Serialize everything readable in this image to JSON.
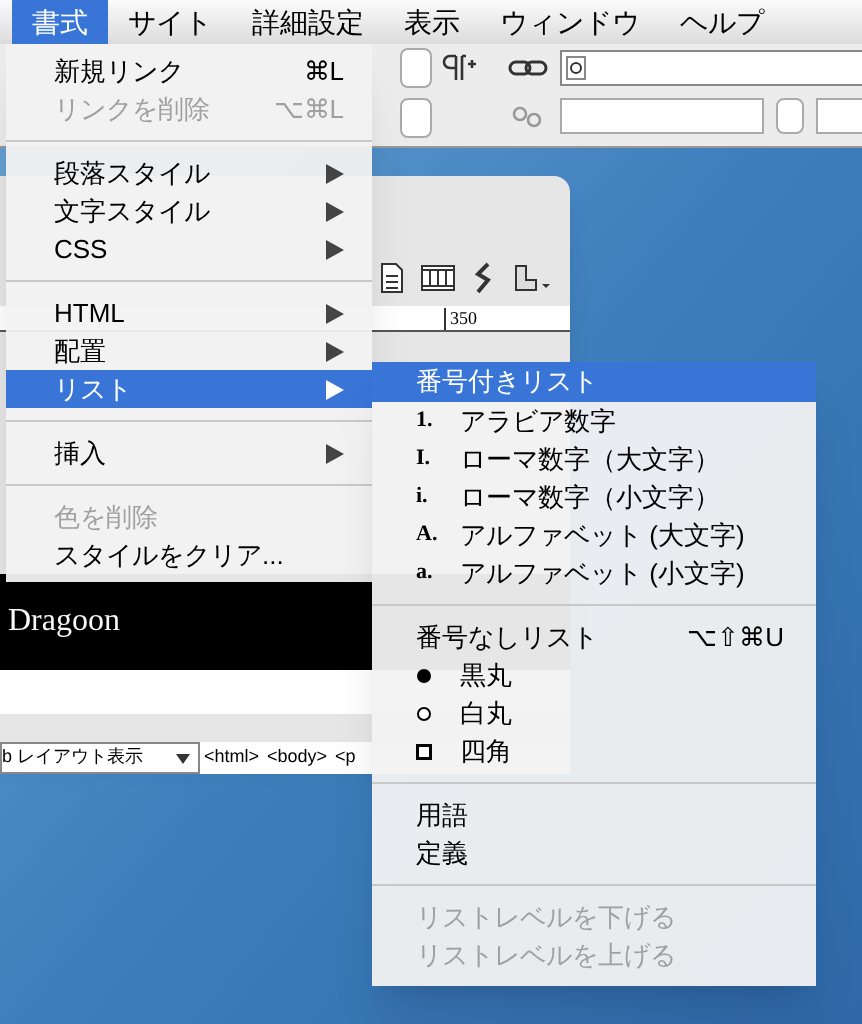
{
  "menubar": [
    {
      "label": "書式",
      "selected": true
    },
    {
      "label": "サイト",
      "selected": false
    },
    {
      "label": "詳細設定",
      "selected": false
    },
    {
      "label": "表示",
      "selected": false
    },
    {
      "label": "ウィンドウ",
      "selected": false
    },
    {
      "label": "ヘルプ",
      "selected": false
    }
  ],
  "document": {
    "ruler_label": "350",
    "heading": "Dragoon",
    "view_menu": "b レイアウト表示",
    "tag_path": [
      "<html>",
      "<body>",
      "<p"
    ]
  },
  "format_menu": {
    "items": [
      {
        "kind": "item",
        "label": "新規リンク",
        "shortcut": "⌘L",
        "disabled": false,
        "selected": false,
        "submenu": false
      },
      {
        "kind": "item",
        "label": "リンクを削除",
        "shortcut": "⌥⌘L",
        "disabled": true,
        "selected": false,
        "submenu": false
      },
      {
        "kind": "separator"
      },
      {
        "kind": "item",
        "label": "段落スタイル",
        "disabled": false,
        "selected": false,
        "submenu": true
      },
      {
        "kind": "item",
        "label": "文字スタイル",
        "disabled": false,
        "selected": false,
        "submenu": true
      },
      {
        "kind": "item",
        "label": "CSS",
        "disabled": false,
        "selected": false,
        "submenu": true
      },
      {
        "kind": "separator"
      },
      {
        "kind": "item",
        "label": "HTML",
        "disabled": false,
        "selected": false,
        "submenu": true
      },
      {
        "kind": "item",
        "label": "配置",
        "disabled": false,
        "selected": false,
        "submenu": true
      },
      {
        "kind": "item",
        "label": "リスト",
        "disabled": false,
        "selected": true,
        "submenu": true
      },
      {
        "kind": "separator"
      },
      {
        "kind": "item",
        "label": "挿入",
        "disabled": false,
        "selected": false,
        "submenu": true
      },
      {
        "kind": "separator"
      },
      {
        "kind": "item",
        "label": "色を削除",
        "disabled": true,
        "selected": false,
        "submenu": false
      },
      {
        "kind": "item",
        "label": "スタイルをクリア...",
        "disabled": false,
        "selected": false,
        "submenu": false
      }
    ]
  },
  "list_submenu": {
    "items": [
      {
        "kind": "plain",
        "label": "番号付きリスト",
        "disabled": false,
        "selected": true
      },
      {
        "kind": "numbered",
        "marker": "1.",
        "label": "アラビア数字",
        "disabled": false,
        "selected": false
      },
      {
        "kind": "numbered",
        "marker": "I.",
        "label": "ローマ数字（大文字）",
        "disabled": false,
        "selected": false
      },
      {
        "kind": "numbered",
        "marker": "i.",
        "label": "ローマ数字（小文字）",
        "disabled": false,
        "selected": false
      },
      {
        "kind": "numbered",
        "marker": "A.",
        "label": "アルファベット (大文字)",
        "disabled": false,
        "selected": false
      },
      {
        "kind": "numbered",
        "marker": "a.",
        "label": "アルファベット (小文字)",
        "disabled": false,
        "selected": false
      },
      {
        "kind": "separator"
      },
      {
        "kind": "plain",
        "label": "番号なしリスト",
        "shortcut": "⌥⇧⌘U",
        "disabled": false,
        "selected": false
      },
      {
        "kind": "disc",
        "label": "黒丸",
        "disabled": false,
        "selected": false
      },
      {
        "kind": "circle",
        "label": "白丸",
        "disabled": false,
        "selected": false
      },
      {
        "kind": "square",
        "label": "四角",
        "disabled": false,
        "selected": false
      },
      {
        "kind": "separator"
      },
      {
        "kind": "plain",
        "label": "用語",
        "disabled": false,
        "selected": false
      },
      {
        "kind": "plain",
        "label": "定義",
        "disabled": false,
        "selected": false
      },
      {
        "kind": "separator"
      },
      {
        "kind": "plain",
        "label": "リストレベルを下げる",
        "disabled": true,
        "selected": false
      },
      {
        "kind": "plain",
        "label": "リストレベルを上げる",
        "disabled": true,
        "selected": false
      }
    ]
  }
}
